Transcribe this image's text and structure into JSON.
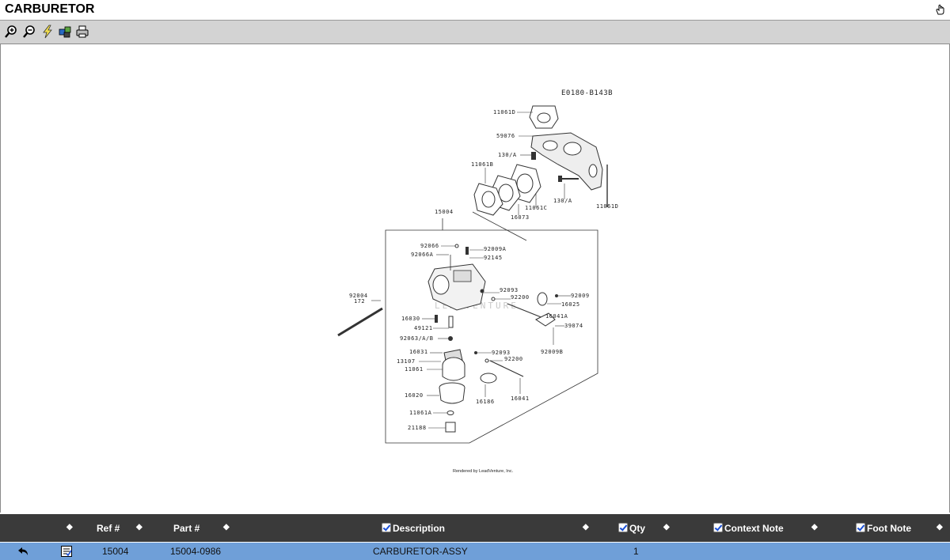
{
  "window": {
    "title": "CARBURETOR"
  },
  "toolbar": {
    "tools": [
      "zoom-in-icon",
      "zoom-out-icon",
      "lightning-icon",
      "puzzle-icon",
      "printer-icon"
    ]
  },
  "diagram": {
    "code": "E0180-B143B",
    "footer": "Rendered by LeadVenture, Inc.",
    "watermark": "LEADVENTURE",
    "labels": {
      "l11061d_top": "11061D",
      "l59076": "59076",
      "l130a_1": "130/A",
      "l11061b": "11061B",
      "l130a_2": "130/A",
      "l11061d_right": "11061D",
      "l11061c": "11061C",
      "l16073": "16073",
      "l15004": "15004",
      "l92066": "92066",
      "l92066a": "92066A",
      "l92009a": "92009A",
      "l92145": "92145",
      "l92004": "92004",
      "l172": "172",
      "l92093_1": "92093",
      "l92200_1": "92200",
      "l92009": "92009",
      "l16025": "16025",
      "l16030": "16030",
      "l16041a": "16041A",
      "l49121": "49121",
      "l39074": "39074",
      "l92063ab": "92063/A/B",
      "l16031": "16031",
      "l92093_2": "92093",
      "l92009b": "92009B",
      "l13107": "13107",
      "l92200_2": "92200",
      "l11061": "11061",
      "l16020": "16020",
      "l16186": "16186",
      "l16041": "16041",
      "l11061a": "11061A",
      "l21188": "21188"
    }
  },
  "grid": {
    "headers": {
      "ref": "Ref #",
      "part": "Part #",
      "description": "Description",
      "qty": "Qty",
      "context_note": "Context Note",
      "foot_note": "Foot Note"
    },
    "rows": [
      {
        "ref": "15004",
        "part": "15004-0986",
        "description": "CARBURETOR-ASSY",
        "qty": "1",
        "context_note": "",
        "foot_note": ""
      }
    ]
  },
  "colors": {
    "header_bg": "#3a3a3a",
    "selected_row": "#6f9fd8",
    "toolbar_bg": "#d3d3d3"
  }
}
